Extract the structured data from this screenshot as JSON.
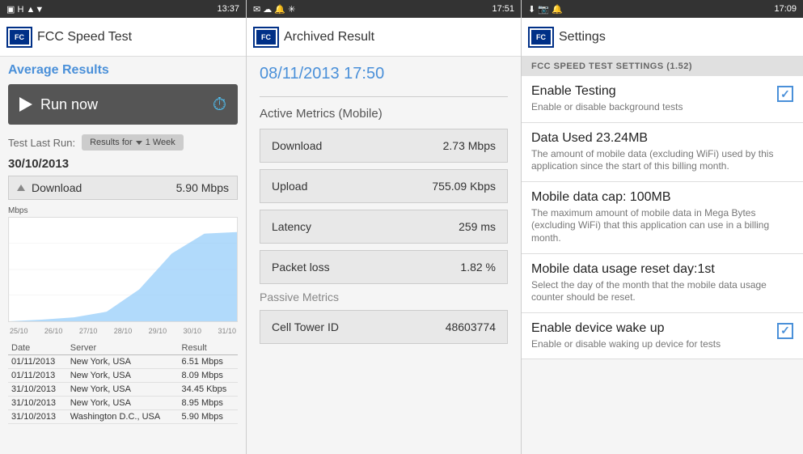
{
  "panel1": {
    "statusBar": {
      "time": "13:37",
      "icons": "H ▲▼ 📶"
    },
    "header": {
      "logo": "FC",
      "title": "FCC Speed Test"
    },
    "avgResultsTitle": "Average Results",
    "runNowLabel": "Run now",
    "testLastLabel": "Test Last Run:",
    "testLastDate": "30/10/2013",
    "resultsFor": "Results for",
    "resultsRange": "1 Week",
    "downloadLabel": "Download",
    "downloadValue": "5.90 Mbps",
    "chartYLabel": "Mbps",
    "chartXLabels": [
      "25/10",
      "26/10",
      "27/10",
      "28/10",
      "29/10",
      "30/10",
      "31/10"
    ],
    "tableHeaders": [
      "Date",
      "Server",
      "Result"
    ],
    "tableRows": [
      [
        "01/11/2013",
        "New York, USA",
        "6.51 Mbps"
      ],
      [
        "01/11/2013",
        "New York, USA",
        "8.09 Mbps"
      ],
      [
        "31/10/2013",
        "New York, USA",
        "34.45 Kbps"
      ],
      [
        "31/10/2013",
        "New York, USA",
        "8.95 Mbps"
      ],
      [
        "31/10/2013",
        "Washington D.C., USA",
        "5.90 Mbps"
      ]
    ]
  },
  "panel2": {
    "statusBar": {
      "time": "17:51"
    },
    "header": {
      "logo": "FC",
      "title": "Archived Result"
    },
    "archivedDate": "08/11/2013 17:50",
    "activeSectionTitle": "Active Metrics (Mobile)",
    "metrics": [
      {
        "label": "Download",
        "value": "2.73 Mbps"
      },
      {
        "label": "Upload",
        "value": "755.09 Kbps"
      },
      {
        "label": "Latency",
        "value": "259 ms"
      },
      {
        "label": "Packet loss",
        "value": "1.82 %"
      }
    ],
    "passiveSectionTitle": "Passive Metrics",
    "passiveMetrics": [
      {
        "label": "Cell Tower ID",
        "value": "48603774"
      }
    ]
  },
  "panel3": {
    "statusBar": {
      "time": "17:09"
    },
    "header": {
      "logo": "FC",
      "title": "Settings"
    },
    "sectionHeader": "FCC SPEED TEST SETTINGS (1.52)",
    "settings": [
      {
        "title": "Enable Testing",
        "desc": "Enable or disable background tests",
        "hasCheckbox": true,
        "checked": true
      },
      {
        "title": "Data Used 23.24MB",
        "desc": "The amount of mobile data (excluding WiFi) used by this application since the start of this billing month.",
        "hasCheckbox": false
      },
      {
        "title": "Mobile data cap: 100MB",
        "desc": "The maximum amount of mobile data in Mega Bytes (excluding WiFi) that this application can use in a billing month.",
        "hasCheckbox": false
      },
      {
        "title": "Mobile data usage reset day:1st",
        "desc": "Select the day of the month that the mobile data usage counter should be reset.",
        "hasCheckbox": false
      },
      {
        "title": "Enable device wake up",
        "desc": "Enable or disable waking up device for tests",
        "hasCheckbox": true,
        "checked": true
      }
    ]
  }
}
